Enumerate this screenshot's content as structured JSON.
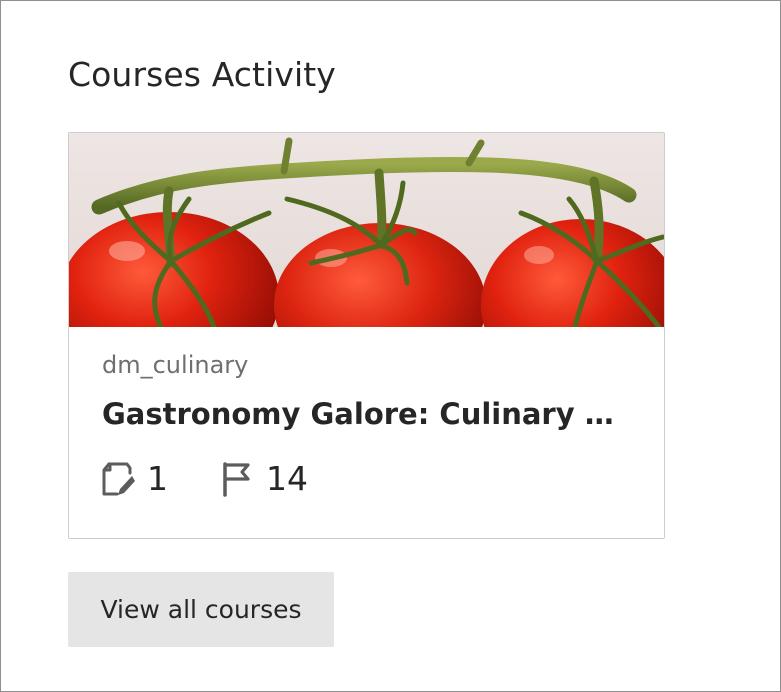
{
  "panel": {
    "title": "Courses Activity"
  },
  "course_card": {
    "image": "tomatoes-on-vine-banner",
    "course_id": "dm_culinary",
    "course_name": "Gastronomy Galore: Culinary Cr...",
    "stats": {
      "assignments": {
        "icon": "assignment-edit-icon",
        "value": "1"
      },
      "flags": {
        "icon": "flag-icon",
        "value": "14"
      }
    }
  },
  "actions": {
    "view_all_label": "View all courses"
  },
  "colors": {
    "text_primary": "#262626",
    "text_secondary": "#6f6f6f",
    "button_bg": "#e5e5e5",
    "border": "#cdcdcd"
  }
}
